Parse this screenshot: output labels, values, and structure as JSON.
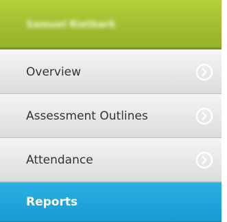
{
  "header": {
    "user_name": "Samuel Rietbark"
  },
  "nav": {
    "items": [
      {
        "label": "Overview",
        "icon": "chevron-right-circle-icon",
        "active": false
      },
      {
        "label": "Assessment Outlines",
        "icon": "chevron-right-circle-icon",
        "active": false
      },
      {
        "label": "Attendance",
        "icon": "chevron-right-circle-icon",
        "active": false
      },
      {
        "label": "Reports",
        "active": true
      }
    ]
  },
  "colors": {
    "header_green": "#a6c236",
    "active_blue": "#1ea6da",
    "item_gray": "#e6e6e6"
  }
}
